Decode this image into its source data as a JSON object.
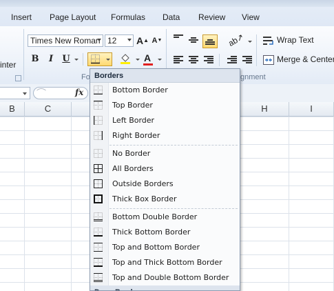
{
  "ribbon": {
    "tabs": [
      "Insert",
      "Page Layout",
      "Formulas",
      "Data",
      "Review",
      "View"
    ],
    "clipboard_partial_label": "inter",
    "font": {
      "family": "Times New Roman",
      "size": "12",
      "bold": "B",
      "italic": "I",
      "underline": "U",
      "grow": "A",
      "shrink": "A",
      "group_label_partial": "Fo"
    },
    "alignment": {
      "wrap_text": "Wrap Text",
      "merge_center": "Merge & Center",
      "group_label_partial": "gnment"
    }
  },
  "formula_bar": {
    "fx": "fx"
  },
  "grid": {
    "columns": [
      "B",
      "C",
      "H",
      "I"
    ]
  },
  "colors": {
    "accent_fill_yellow": "#ffd970",
    "font_color_red": "#e02020",
    "highlight_yellow": "#ffee00"
  },
  "borders_menu": {
    "header": "Borders",
    "group_borders": [
      {
        "label": "Bottom Border",
        "icon": "bottom-border-icon"
      },
      {
        "label": "Top Border",
        "icon": "top-border-icon"
      },
      {
        "label": "Left Border",
        "icon": "left-border-icon"
      },
      {
        "label": "Right Border",
        "icon": "right-border-icon"
      }
    ],
    "group_all": [
      {
        "label": "No Border",
        "icon": "no-border-icon"
      },
      {
        "label": "All Borders",
        "icon": "all-borders-icon"
      },
      {
        "label": "Outside Borders",
        "icon": "outside-borders-icon"
      },
      {
        "label": "Thick Box Border",
        "icon": "thick-box-border-icon"
      }
    ],
    "group_combo": [
      {
        "label": "Bottom Double Border",
        "icon": "bottom-double-border-icon"
      },
      {
        "label": "Thick Bottom Border",
        "icon": "thick-bottom-border-icon"
      },
      {
        "label": "Top and Bottom Border",
        "icon": "top-bottom-border-icon"
      },
      {
        "label": "Top and Thick Bottom Border",
        "icon": "top-thick-bottom-border-icon"
      },
      {
        "label": "Top and Double Bottom Border",
        "icon": "top-double-bottom-border-icon"
      }
    ],
    "draw_header_partial": "Draw Borders"
  }
}
